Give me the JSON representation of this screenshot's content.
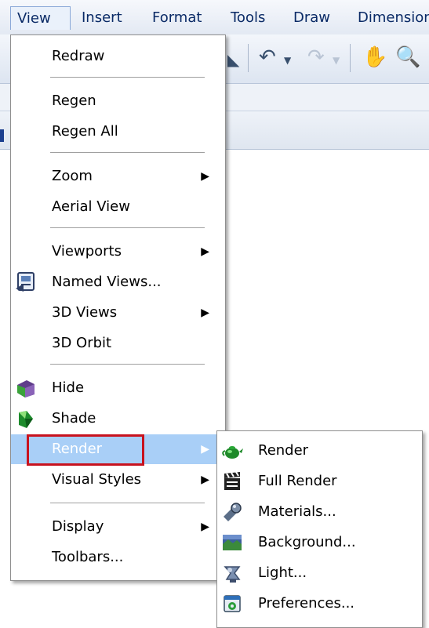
{
  "menubar": {
    "items": [
      "View",
      "Insert",
      "Format",
      "Tools",
      "Draw",
      "Dimension"
    ]
  },
  "view_menu": {
    "items": [
      {
        "label": "Redraw"
      },
      {
        "label": "Regen"
      },
      {
        "label": "Regen All"
      },
      {
        "label": "Zoom"
      },
      {
        "label": "Aerial View"
      },
      {
        "label": "Viewports"
      },
      {
        "label": "Named Views..."
      },
      {
        "label": "3D Views"
      },
      {
        "label": "3D Orbit"
      },
      {
        "label": "Hide"
      },
      {
        "label": "Shade"
      },
      {
        "label": "Render"
      },
      {
        "label": "Visual Styles"
      },
      {
        "label": "Display"
      },
      {
        "label": "Toolbars..."
      }
    ]
  },
  "render_submenu": {
    "items": [
      {
        "label": "Render"
      },
      {
        "label": "Full Render"
      },
      {
        "label": "Materials..."
      },
      {
        "label": "Background..."
      },
      {
        "label": "Light..."
      },
      {
        "label": "Preferences..."
      }
    ]
  },
  "colors": {
    "highlight": "#a9cff7",
    "annotation_box": "#c8121e"
  },
  "icons": {
    "named_views": "named-views-icon",
    "hide": "hide-icon",
    "shade": "shade-icon",
    "render": "teapot-render-icon",
    "full_render": "clapperboard-icon",
    "materials": "materials-icon",
    "background": "background-landscape-icon",
    "light": "light-icon",
    "preferences": "preferences-icon"
  }
}
